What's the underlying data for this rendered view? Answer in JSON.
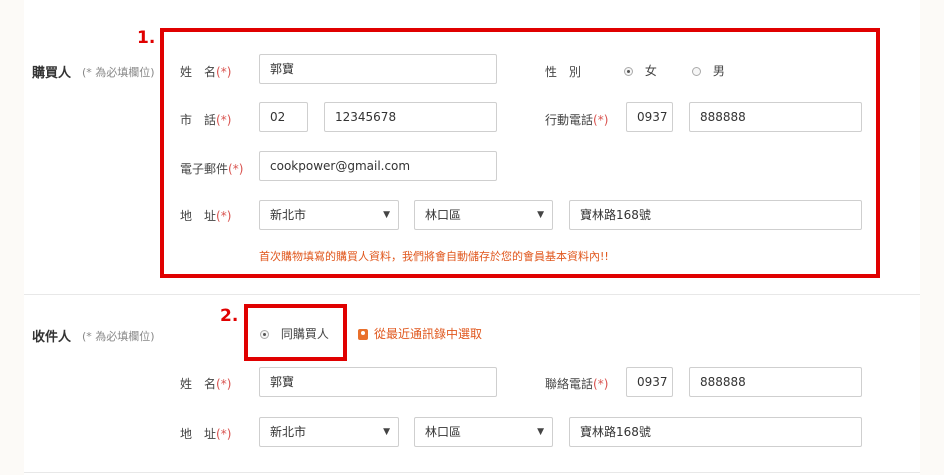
{
  "buyer": {
    "title": "購買人",
    "required_note": "(* 為必填欄位)",
    "name_label": "姓　名",
    "name_value": "郭寶",
    "gender_label": "性　別",
    "gender_options": [
      "女",
      "男"
    ],
    "gender_selected": "女",
    "phone_label": "市　話",
    "phone_area": "02",
    "phone_number": "12345678",
    "mobile_label": "行動電話",
    "mobile_prefix": "0937",
    "mobile_number": "888888",
    "email_label": "電子郵件",
    "email_value": "cookpower@gmail.com",
    "address_label": "地　址",
    "city": "新北市",
    "district": "林口區",
    "street": "寶林路168號",
    "hint": "首次購物填寫的購買人資料，我們將會自動儲存於您的會員基本資料內!!"
  },
  "receiver": {
    "title": "收件人",
    "required_note": "(* 為必填欄位)",
    "same_as_buyer_label": "同購買人",
    "contacts_link": "從最近通訊錄中選取",
    "name_label": "姓　名",
    "name_value": "郭寶",
    "phone_label": "聯絡電話",
    "phone_prefix": "0937",
    "phone_number": "888888",
    "address_label": "地　址",
    "city": "新北市",
    "district": "林口區",
    "street": "寶林路168號"
  },
  "annotations": {
    "box1_number": "1.",
    "box2_number": "2."
  },
  "required_star": "(*)",
  "colors": {
    "annotation_red": "#e00000",
    "hint_orange": "#e0571d",
    "required_red": "#d9534f"
  }
}
